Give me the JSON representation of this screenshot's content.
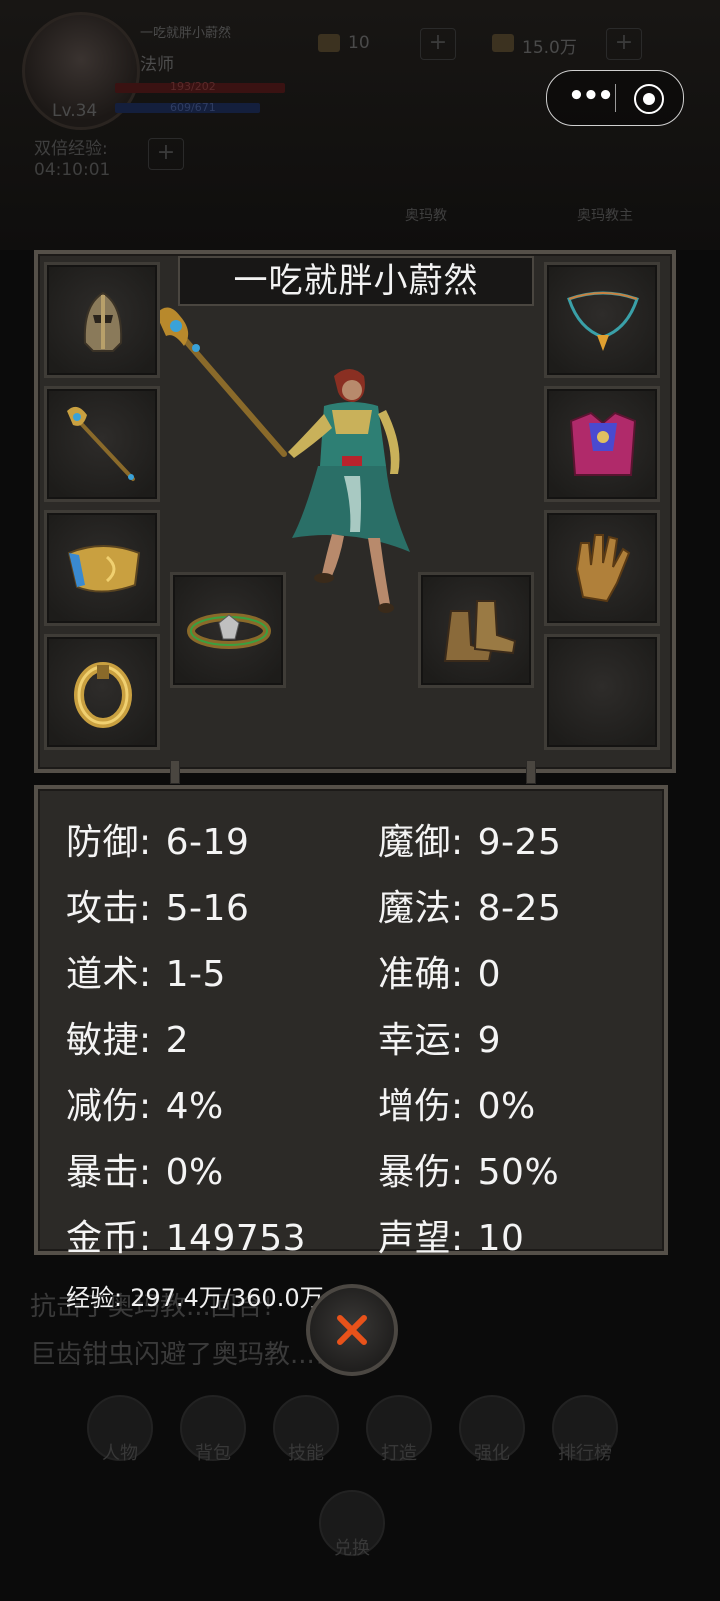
{
  "background": {
    "player_name": "一吃就胖小蔚然",
    "player_class": "法师",
    "hp": "193/202",
    "mp": "609/671",
    "level": "Lv.34",
    "double_exp_label": "双倍经验:",
    "double_exp_timer": "04:10:01",
    "gems": "10",
    "gold": "15.0万",
    "target_left": "奥玛教",
    "target_right": "奥玛教主",
    "log_line_1": "抗击了奥玛教...回合!",
    "log_line_2": "巨齿钳虫闪避了奥玛教...击!",
    "nav": [
      "人物",
      "背包",
      "技能",
      "打造",
      "强化",
      "排行榜"
    ],
    "exchange": "兑换"
  },
  "equipment": {
    "character_name": "一吃就胖小蔚然",
    "slots": {
      "helmet": "helmet-icon",
      "weapon": "staff-icon",
      "bracelet": "bracer-icon",
      "ring_left": "ring-icon",
      "belt": "belt-icon",
      "necklace": "necklace-icon",
      "armor": "robe-icon",
      "gloves": "glove-icon",
      "boots": "boots-icon",
      "ring_right": "empty"
    }
  },
  "stats": {
    "defense": {
      "label": "防御:",
      "value": "6-19"
    },
    "magic_defense": {
      "label": "魔御:",
      "value": "9-25"
    },
    "attack": {
      "label": "攻击:",
      "value": "5-16"
    },
    "magic": {
      "label": "魔法:",
      "value": "8-25"
    },
    "tao": {
      "label": "道术:",
      "value": "1-5"
    },
    "accuracy": {
      "label": "准确:",
      "value": "0"
    },
    "agility": {
      "label": "敏捷:",
      "value": "2"
    },
    "luck": {
      "label": "幸运:",
      "value": "9"
    },
    "damage_reduction": {
      "label": "减伤:",
      "value": "4%"
    },
    "damage_increase": {
      "label": "增伤:",
      "value": "0%"
    },
    "crit": {
      "label": "暴击:",
      "value": "0%"
    },
    "crit_damage": {
      "label": "暴伤:",
      "value": "50%"
    },
    "gold": {
      "label": "金币:",
      "value": "149753"
    },
    "reputation": {
      "label": "声望:",
      "value": "10"
    }
  },
  "experience": {
    "label": "经验:",
    "value": "297.4万/360.0万"
  },
  "colors": {
    "panel_bg": "#2c2a27",
    "panel_border": "#555049",
    "close_x": "#e8521a",
    "text": "#f4f4f4"
  }
}
